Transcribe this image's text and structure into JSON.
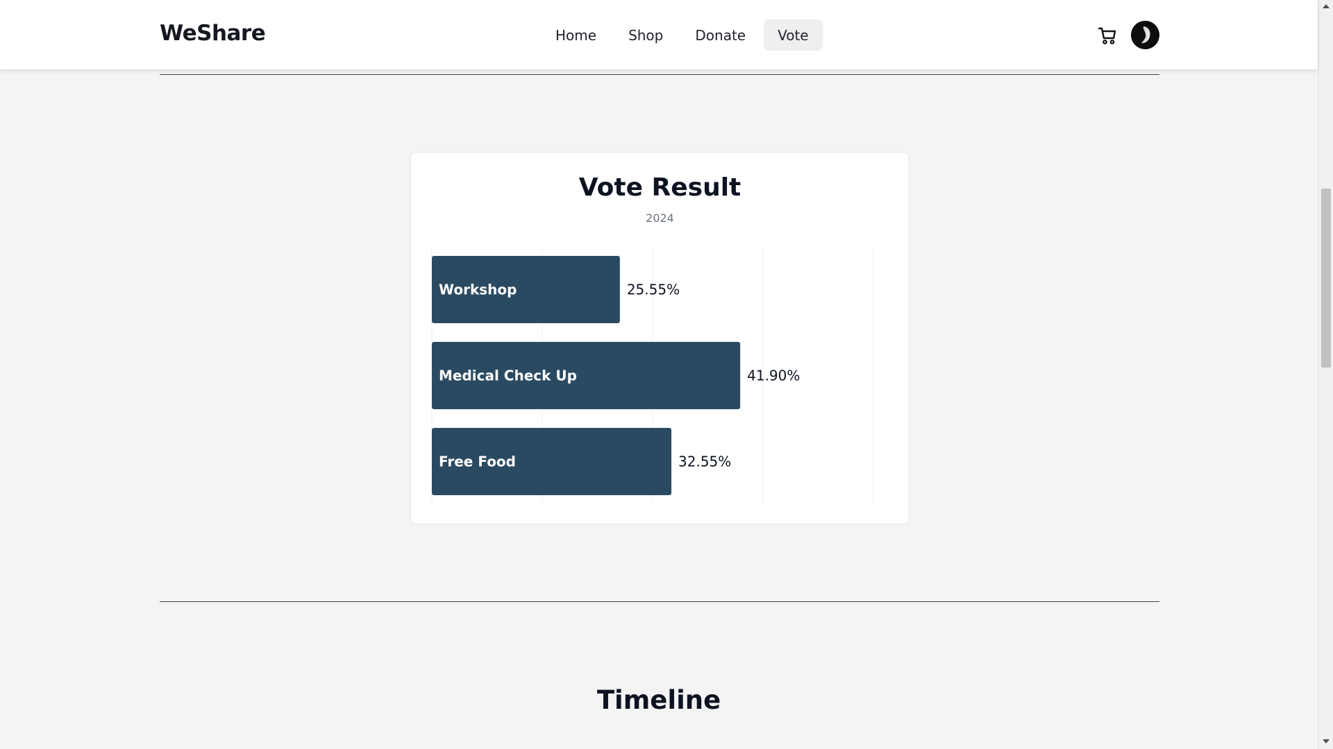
{
  "header": {
    "logo": "WeShare",
    "nav": [
      {
        "label": "Home"
      },
      {
        "label": "Shop"
      },
      {
        "label": "Donate"
      },
      {
        "label": "Vote",
        "active": true
      }
    ],
    "icons": {
      "cart": "cart-icon",
      "avatar": "avatar"
    }
  },
  "vote_card": {
    "title": "Vote Result",
    "subtitle": "2024"
  },
  "chart_data": {
    "type": "bar",
    "orientation": "horizontal",
    "title": "Vote Result",
    "subtitle": "2024",
    "categories": [
      "Workshop",
      "Medical Check Up",
      "Free Food"
    ],
    "values": [
      25.55,
      41.9,
      32.55
    ],
    "value_labels": [
      "25.55%",
      "41.90%",
      "32.55%"
    ],
    "xlim": [
      0,
      60
    ],
    "grid": true,
    "bar_color": "#2a4a62"
  },
  "timeline": {
    "title": "Timeline"
  },
  "colors": {
    "background": "#f4f4f4",
    "bar": "#2a4a62",
    "divider": "#3a4257"
  }
}
